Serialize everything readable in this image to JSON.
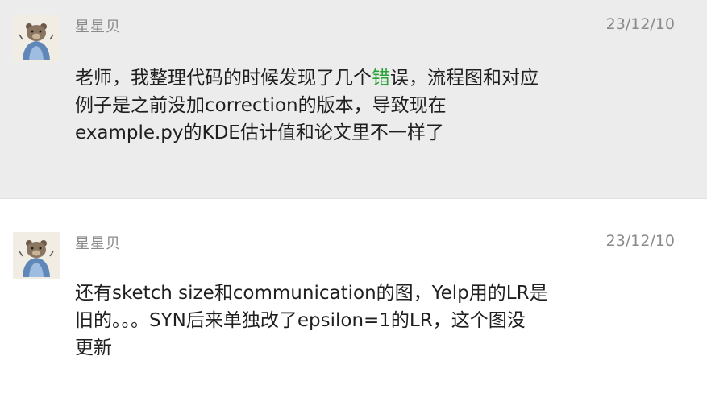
{
  "messages": [
    {
      "sender": "星星贝",
      "date": "23/12/10",
      "text_before": "老师，我整理代码的时候发现了几个",
      "highlight": "错",
      "text_after": "误，流程图和对应\n例子是之前没加correction的版本，导致现在\nexample.py的KDE估计值和论文里不一样了",
      "highlight_color": "#2ba13a"
    },
    {
      "sender": "星星贝",
      "date": "23/12/10",
      "text": "还有sketch size和communication的图，Yelp用的LR是\n旧的。。。SYN后来单独改了epsilon=1的LR，这个图没\n更新"
    }
  ],
  "colors": {
    "first_row_bg": "#ececec",
    "second_row_bg": "#ffffff",
    "meta_text": "#8a8a8a",
    "body_text": "#1f1f1f"
  },
  "icons": {
    "avatar": "bear-avatar-icon"
  }
}
